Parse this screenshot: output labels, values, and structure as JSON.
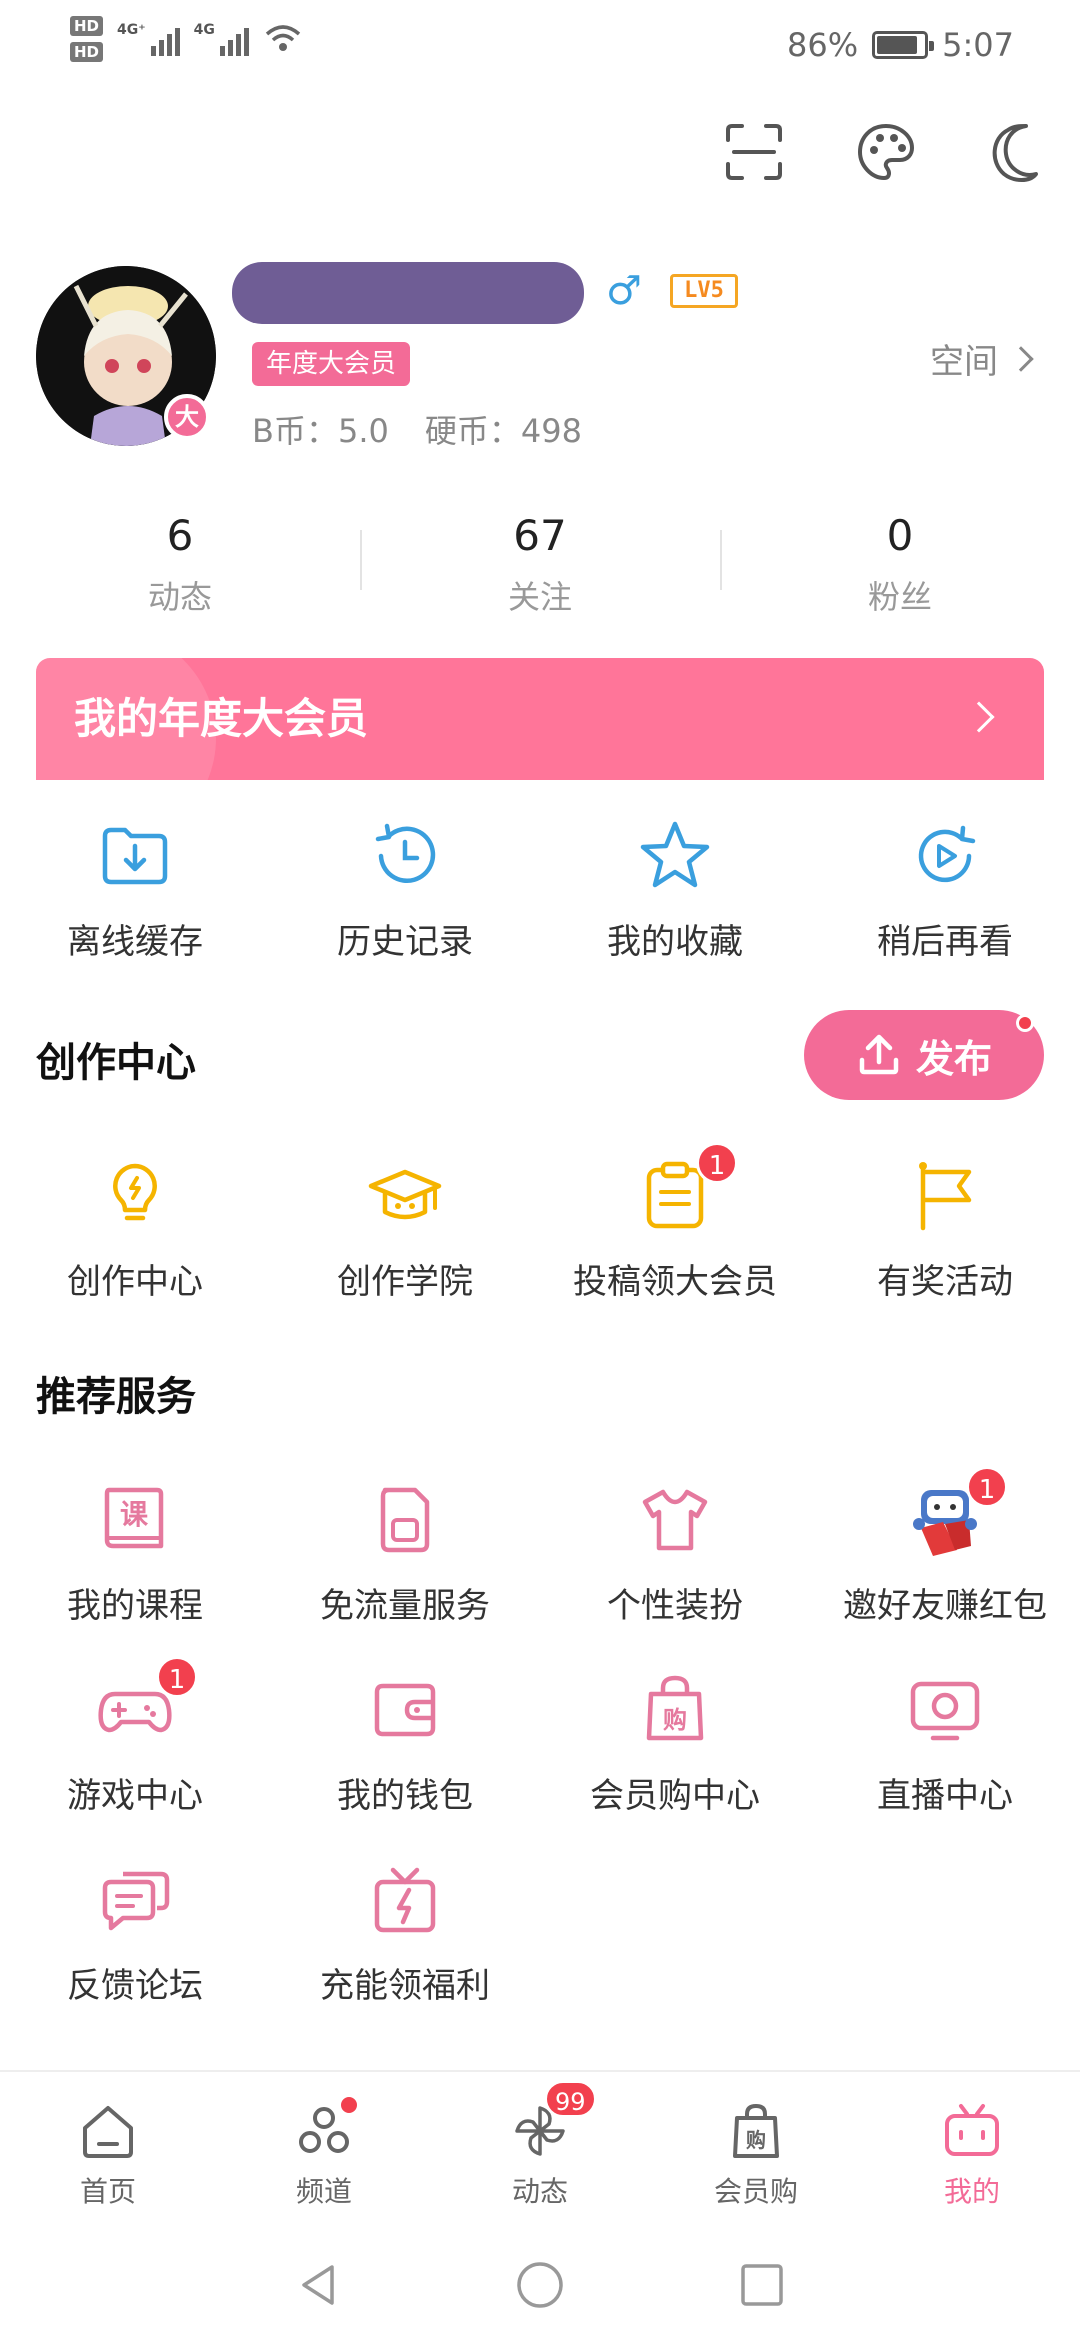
{
  "status_bar": {
    "hd1": "HD",
    "hd2": "HD",
    "net1": "4G⁺",
    "net2": "4G",
    "battery": "86%",
    "time": "5:07"
  },
  "top_icons": [
    "scan-icon",
    "palette-icon",
    "moon-icon"
  ],
  "profile": {
    "vip_tag": "年度大会员",
    "gender_icon": "male-icon",
    "level": "LV5",
    "avatar_badge": "大",
    "bcoin": "B币：5.0",
    "coin": "硬币：498",
    "space": "空间"
  },
  "stats": [
    {
      "num": "6",
      "label": "动态"
    },
    {
      "num": "67",
      "label": "关注"
    },
    {
      "num": "0",
      "label": "粉丝"
    }
  ],
  "vip_banner": "我的年度大会员",
  "quick_actions": [
    {
      "label": "离线缓存",
      "icon": "download-folder-icon"
    },
    {
      "label": "历史记录",
      "icon": "history-icon"
    },
    {
      "label": "我的收藏",
      "icon": "star-icon"
    },
    {
      "label": "稍后再看",
      "icon": "watch-later-icon"
    }
  ],
  "creation": {
    "title": "创作中心",
    "publish": "发布",
    "items": [
      {
        "label": "创作中心",
        "icon": "lightbulb-icon"
      },
      {
        "label": "创作学院",
        "icon": "graduation-cap-icon"
      },
      {
        "label": "投稿领大会员",
        "icon": "clipboard-icon",
        "badge": "1"
      },
      {
        "label": "有奖活动",
        "icon": "flag-icon"
      }
    ]
  },
  "services": {
    "title": "推荐服务",
    "items": [
      {
        "label": "我的课程",
        "icon": "course-book-icon",
        "glyph": "课"
      },
      {
        "label": "免流量服务",
        "icon": "sim-card-icon"
      },
      {
        "label": "个性装扮",
        "icon": "tshirt-icon"
      },
      {
        "label": "邀好友赚红包",
        "icon": "mascot-red-envelope-icon",
        "badge": "1"
      },
      {
        "label": "游戏中心",
        "icon": "gamepad-icon",
        "badge": "1"
      },
      {
        "label": "我的钱包",
        "icon": "wallet-icon"
      },
      {
        "label": "会员购中心",
        "icon": "shopping-bag-icon",
        "glyph": "购"
      },
      {
        "label": "直播中心",
        "icon": "live-tv-icon"
      },
      {
        "label": "反馈论坛",
        "icon": "feedback-chat-icon"
      },
      {
        "label": "充能领福利",
        "icon": "gift-bolt-icon"
      }
    ]
  },
  "bottom_nav": [
    {
      "label": "首页",
      "icon": "home-icon"
    },
    {
      "label": "频道",
      "icon": "channel-icon",
      "dot": true
    },
    {
      "label": "动态",
      "icon": "pinwheel-icon",
      "badge": "99"
    },
    {
      "label": "会员购",
      "icon": "shop-bag-icon",
      "glyph": "购"
    },
    {
      "label": "我的",
      "icon": "tv-mascot-icon",
      "active": true
    }
  ],
  "colors": {
    "accent": "#f36b97",
    "blue": "#3a9fde",
    "yellow": "#f5b400",
    "badge": "#f2404e"
  }
}
